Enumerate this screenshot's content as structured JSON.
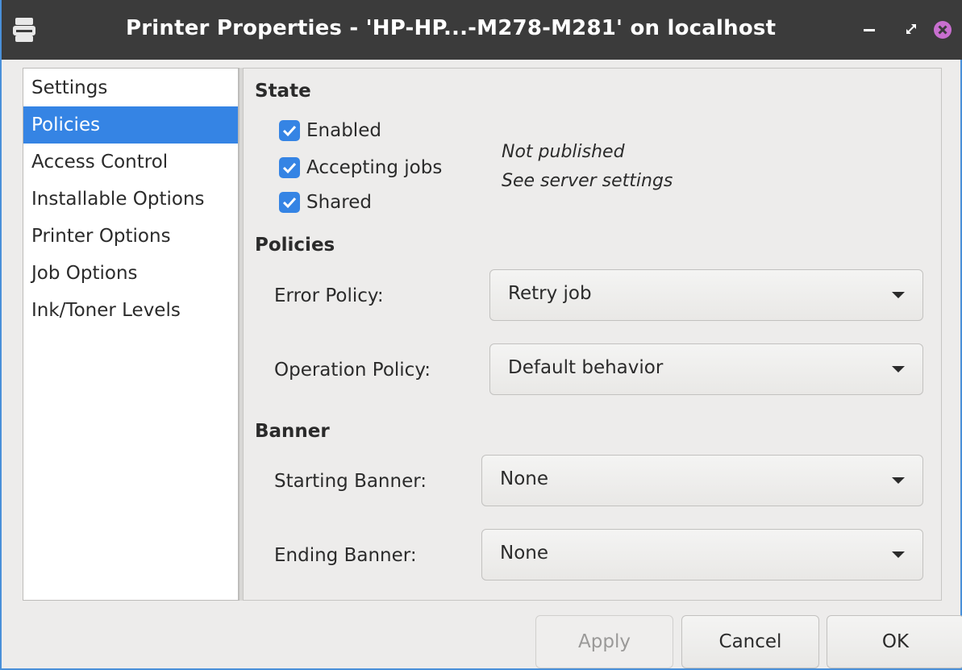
{
  "window": {
    "title": "Printer Properties - 'HP-HP...-M278-M281' on localhost",
    "icons": {
      "app": "printer-icon",
      "minimize": "minimize-icon",
      "maximize": "maximize-icon",
      "close": "close-icon"
    },
    "accent": "#3584e4"
  },
  "sidebar": {
    "items": [
      {
        "label": "Settings",
        "selected": false
      },
      {
        "label": "Policies",
        "selected": true
      },
      {
        "label": "Access Control",
        "selected": false
      },
      {
        "label": "Installable Options",
        "selected": false
      },
      {
        "label": "Printer Options",
        "selected": false
      },
      {
        "label": "Job Options",
        "selected": false
      },
      {
        "label": "Ink/Toner Levels",
        "selected": false
      }
    ]
  },
  "state": {
    "heading": "State",
    "enabled": {
      "label": "Enabled",
      "checked": true
    },
    "accepting": {
      "label": "Accepting jobs",
      "checked": true
    },
    "shared": {
      "label": "Shared",
      "checked": true
    },
    "note_line1": "Not published",
    "note_line2": "See server settings"
  },
  "policies": {
    "heading": "Policies",
    "error_label": "Error Policy:",
    "error_value": "Retry job",
    "operation_label": "Operation Policy:",
    "operation_value": "Default behavior"
  },
  "banner": {
    "heading": "Banner",
    "starting_label": "Starting Banner:",
    "starting_value": "None",
    "ending_label": "Ending Banner:",
    "ending_value": "None"
  },
  "buttons": {
    "apply": "Apply",
    "cancel": "Cancel",
    "ok": "OK"
  }
}
